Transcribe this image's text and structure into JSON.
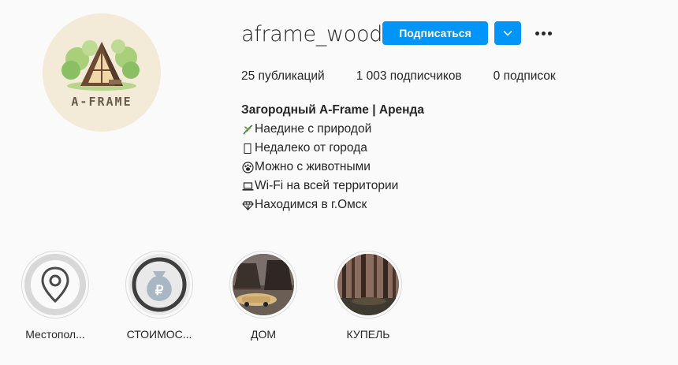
{
  "profile": {
    "username": "aframe_wood",
    "logo_text": "A-FRAME",
    "follow_label": "Подписаться",
    "stats": {
      "posts": "25 публикаций",
      "followers": "1 003 подписчиков",
      "following": "0 подписок"
    },
    "bio": {
      "name": "Загородный A-Frame | Аренда",
      "lines": [
        {
          "icon": "plant-icon",
          "text": "Наедине с природой"
        },
        {
          "icon": "missing-glyph-icon",
          "text": "Недалеко от города"
        },
        {
          "icon": "paw-icon",
          "text": "Можно с животными"
        },
        {
          "icon": "laptop-icon",
          "text": "Wi-Fi на всей территории"
        },
        {
          "icon": "diamond-icon",
          "text": "Находимся в г.Омск"
        }
      ]
    }
  },
  "highlights": [
    {
      "label": "Местопол...",
      "icon": "location-pin-icon"
    },
    {
      "label": "СТОИМОС...",
      "icon": "money-bag-icon"
    },
    {
      "label": "ДОМ",
      "icon": "house-photo"
    },
    {
      "label": "КУПЕЛЬ",
      "icon": "forest-photo"
    }
  ],
  "colors": {
    "accent": "#0095f6",
    "background": "#fafafa",
    "text": "#262626"
  }
}
